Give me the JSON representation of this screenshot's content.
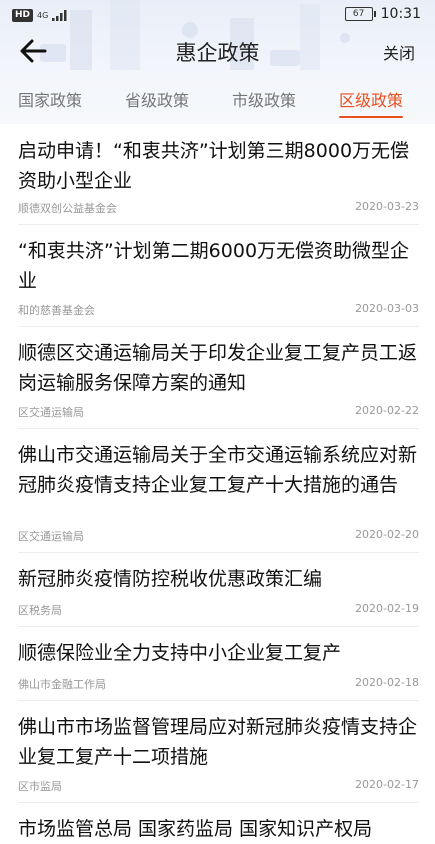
{
  "status_bar": {
    "network": "4G",
    "battery": "67",
    "time": "10:31"
  },
  "header": {
    "title": "惠企政策",
    "close_label": "关闭"
  },
  "tabs": [
    {
      "label": "国家政策",
      "active": false
    },
    {
      "label": "省级政策",
      "active": false
    },
    {
      "label": "市级政策",
      "active": false
    },
    {
      "label": "区级政策",
      "active": true
    }
  ],
  "articles": [
    {
      "title": "启动申请！“和衷共济”计划第三期8000万无偿资助小型企业",
      "source": "顺德双创公益基金会",
      "date": "2020-03-23"
    },
    {
      "title": "“和衷共济”计划第二期6000万无偿资助微型企业",
      "source": "和的慈善基金会",
      "date": "2020-03-03"
    },
    {
      "title": "顺德区交通运输局关于印发企业复工复产员工返岗运输服务保障方案的通知",
      "source": "区交通运输局",
      "date": "2020-02-22"
    },
    {
      "title": "佛山市交通运输局关于全市交通运输系统应对新冠肺炎疫情支持企业复工复产十大措施的通告",
      "source": "区交通运输局",
      "date": "2020-02-20"
    },
    {
      "title": "新冠肺炎疫情防控税收优惠政策汇编",
      "source": "区税务局",
      "date": "2020-02-19"
    },
    {
      "title": "顺德保险业全力支持中小企业复工复产",
      "source": "佛山市金融工作局",
      "date": "2020-02-18"
    },
    {
      "title": "佛山市市场监督管理局应对新冠肺炎疫情支持企业复工复产十二项措施",
      "source": "区市监局",
      "date": "2020-02-17"
    },
    {
      "title": "市场监管总局 国家药监局 国家知识产权局",
      "source": "",
      "date": ""
    }
  ],
  "colors": {
    "accent": "#e8501f",
    "header_bg": "#eef2f9",
    "divider": "#ececec"
  }
}
